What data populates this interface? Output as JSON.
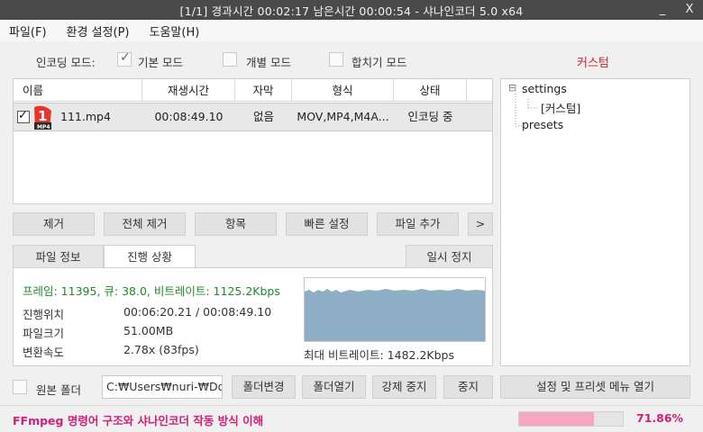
{
  "window": {
    "title": "[1/1] 경과시간  00:02:17   남은시간  00:00:54  - 샤나인코더  5.0  x64",
    "minimize": "_",
    "close": "X"
  },
  "menu": [
    {
      "label": "파일(F)"
    },
    {
      "label": "환경 설정(P)"
    },
    {
      "label": "도움말(H)"
    }
  ],
  "mode": {
    "label": "인코딩 모드:",
    "options": [
      {
        "label": "기본 모드",
        "checked": true
      },
      {
        "label": "개별 모드",
        "checked": false
      },
      {
        "label": "합치기 모드",
        "checked": false
      }
    ],
    "custom": "커스텀"
  },
  "table": {
    "columns": [
      "이름",
      "재생시간",
      "자막",
      "형식",
      "상태"
    ],
    "rows": [
      {
        "name": "111.mp4",
        "duration": "00:08:49.10",
        "subtitle": "없음",
        "format": "MOV,MP4,M4A...",
        "status": "인코딩 중",
        "checked": true,
        "icon_badge": "1",
        "icon_ext": "MP4"
      }
    ]
  },
  "tree": {
    "root": "settings",
    "child": "[커스텀]",
    "sibling": "presets",
    "expander": "⊟"
  },
  "actions": {
    "remove": "제거",
    "remove_all": "전체 제거",
    "item": "항목",
    "quick_setup": "빠른 설정",
    "add_file": "파일 추가",
    "more": ">"
  },
  "tabs": {
    "file_info": "파일 정보",
    "progress": "진행 상황",
    "pause": "일시 정지"
  },
  "progress_info": {
    "stats": "프레임: 11395, 큐: 38.0, 비트레이트: 1125.2Kbps",
    "position_label": "진행위치",
    "position_value": "00:06:20.21 / 00:08:49.10",
    "size_label": "파일크기",
    "size_value": "51.00MB",
    "speed_label": "변환속도",
    "speed_value": "2.78x (83fps)",
    "max_bitrate": "최대 비트레이트: 1482.2Kbps",
    "graph_color": "#8eaec6"
  },
  "bottom": {
    "source_folder_label": "원본 폴더",
    "path": "C:₩Users₩nuri-₩Doc",
    "change_folder": "폴더변경",
    "open_folder": "폴더열기",
    "force_stop": "강제 중지",
    "stop": "중지",
    "settings_menu": "설정 및 프리셋 메뉴 열기"
  },
  "status": {
    "text": "FFmpeg 명령어 구조와 샤나인코더 작동 방식 이해",
    "progress_fraction": 0.72,
    "percent": "71.86%",
    "accent": "#d0207a",
    "bar_color": "#f4a7be"
  }
}
